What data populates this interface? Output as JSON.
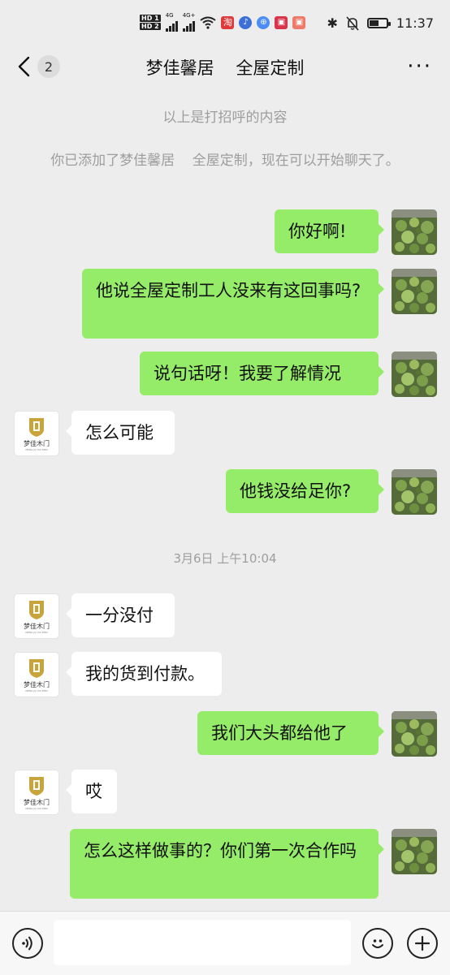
{
  "status_bar": {
    "hd1": "HD 1",
    "hd2": "HD 2",
    "net1": "4G",
    "net2": "4G+",
    "app_labels": [
      "淘",
      "♪",
      "⊕",
      "▣",
      "▣"
    ],
    "bluetooth": "✱",
    "silent": "🔕",
    "battery_level": 0.55,
    "time": "11:37"
  },
  "header": {
    "back_count": "2",
    "title": "梦佳馨居    全屋定制",
    "more": "···"
  },
  "system": {
    "greeting_note": "以上是打招呼的内容",
    "added_note": "你已添加了梦佳馨居    全屋定制，现在可以开始聊天了。",
    "timestamp": "3月6日 上午10:04"
  },
  "contact_logo": {
    "name": "梦佳木门",
    "sub": "MENG JIA MU MEN"
  },
  "messages": [
    {
      "from": "me",
      "text": "你好啊!"
    },
    {
      "from": "me",
      "text": "他说全屋定制工人没来有这回事吗?"
    },
    {
      "from": "me",
      "text": "说句话呀！我要了解情况"
    },
    {
      "from": "them",
      "text": "怎么可能"
    },
    {
      "from": "me",
      "text": "他钱没给足你?"
    },
    {
      "from": "them",
      "text": "一分没付"
    },
    {
      "from": "them",
      "text": "我的货到付款。"
    },
    {
      "from": "me",
      "text": "我们大头都给他了"
    },
    {
      "from": "them",
      "text": "哎"
    },
    {
      "from": "me",
      "text": "怎么这样做事的？你们第一次合作吗"
    }
  ],
  "bottom_bar": {
    "voice_icon": "voice-icon",
    "emoji_icon": "emoji-icon",
    "plus_icon": "plus-icon",
    "input_value": ""
  },
  "colors": {
    "background": "#ededed",
    "my_bubble": "#95ec69",
    "their_bubble": "#ffffff",
    "system_text": "#9e9e9e"
  }
}
